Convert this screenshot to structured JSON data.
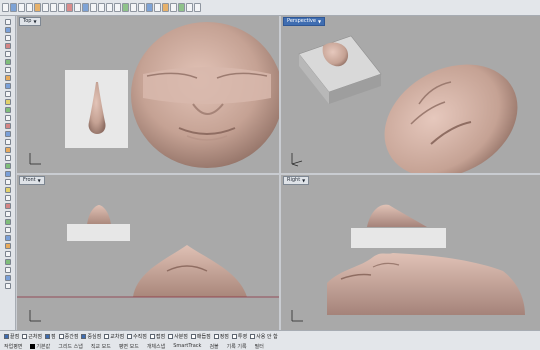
{
  "viewports": {
    "top": {
      "label": "Top"
    },
    "perspective": {
      "label": "Perspective"
    },
    "front": {
      "label": "Front"
    },
    "right": {
      "label": "Right"
    }
  },
  "colors": {
    "viewport_bg": "#a9a9a9",
    "model_skin": "#c9a79a",
    "panel_bg": "#e7e7e7",
    "ground_line": "#8b2f3f",
    "active_tab": "#3f6db1"
  },
  "status_snaps": [
    {
      "label": "끝점",
      "checked": true
    },
    {
      "label": "근처점",
      "checked": false
    },
    {
      "label": "점",
      "checked": true
    },
    {
      "label": "중간점",
      "checked": false
    },
    {
      "label": "중심점",
      "checked": true
    },
    {
      "label": "교차점",
      "checked": false
    },
    {
      "label": "수직점",
      "checked": false
    },
    {
      "label": "접점",
      "checked": false
    },
    {
      "label": "사분점",
      "checked": false
    },
    {
      "label": "매듭점",
      "checked": false
    },
    {
      "label": "정점",
      "checked": false
    },
    {
      "label": "투영",
      "checked": false
    },
    {
      "label": "사용 안 함",
      "checked": false
    }
  ],
  "status": {
    "cplane": "작업평면",
    "layer": "기본값",
    "grid_snap": "그리드 스냅",
    "ortho": "직교 모드",
    "planar": "평면 모드",
    "osnap": "개체스냅",
    "smarttrack": "SmartTrack",
    "gumball": "검볼",
    "history": "기록 기록",
    "filter": "필터"
  }
}
